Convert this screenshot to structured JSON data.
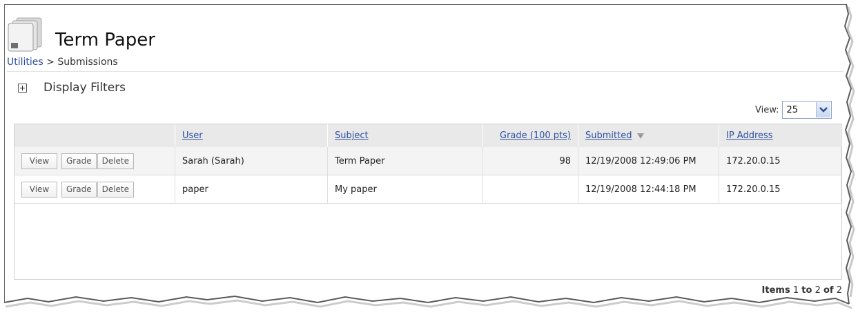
{
  "page": {
    "title": "Term Paper",
    "icon": "page-stack-icon"
  },
  "breadcrumb": {
    "link": "Utilities",
    "separator": ">",
    "current": "Submissions"
  },
  "filters": {
    "toggle_label": "Display Filters",
    "icon": "expand-plus-icon"
  },
  "view_select": {
    "label": "View:",
    "value": "25",
    "icon": "chevron-down-icon"
  },
  "grid": {
    "columns": [
      {
        "label": "",
        "link": false
      },
      {
        "label": "User",
        "link": true
      },
      {
        "label": "Subject",
        "link": true
      },
      {
        "label": "Grade (100 pts)",
        "link": true
      },
      {
        "label": "Submitted",
        "link": true,
        "sorted": "descending"
      },
      {
        "label": "IP Address",
        "link": true
      }
    ],
    "actions": {
      "view": "View",
      "grade": "Grade",
      "delete": "Delete"
    },
    "rows": [
      {
        "user": "Sarah (Sarah)",
        "subject": "Term Paper",
        "grade": "98",
        "submitted": "12/19/2008 12:49:06 PM",
        "ip": "172.20.0.15"
      },
      {
        "user": "paper",
        "subject": "My paper",
        "grade": "",
        "submitted": "12/19/2008 12:44:18 PM",
        "ip": "172.20.0.15"
      }
    ]
  },
  "pager": {
    "items_word": "Items",
    "from": "1",
    "to_word": "to",
    "to": "2",
    "of_word": "of",
    "total": "2"
  },
  "colors": {
    "link": "#2b4fa0",
    "header_bg": "#e9e9e9",
    "border": "#cfcfcf"
  }
}
